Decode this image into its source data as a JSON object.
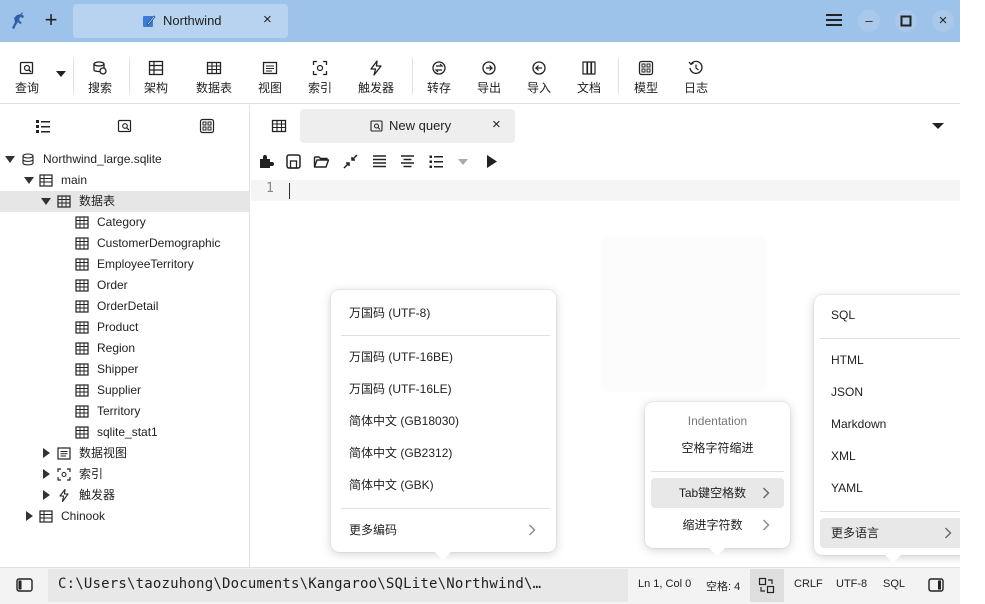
{
  "titlebar": {
    "new_tab": "+",
    "active_tab": "Northwind",
    "close_tab": "×",
    "minimize": "–",
    "maximize": "□",
    "close": "×"
  },
  "toolbar": {
    "items": [
      {
        "label": "查询",
        "icon": "query-icon"
      },
      {
        "label": "搜索",
        "icon": "search-db-icon"
      },
      {
        "label": "架构",
        "icon": "schema-icon"
      },
      {
        "label": "数据表",
        "icon": "table-icon"
      },
      {
        "label": "视图",
        "icon": "view-icon"
      },
      {
        "label": "索引",
        "icon": "index-icon"
      },
      {
        "label": "触发器",
        "icon": "trigger-icon"
      },
      {
        "label": "转存",
        "icon": "dump-icon"
      },
      {
        "label": "导出",
        "icon": "export-icon"
      },
      {
        "label": "导入",
        "icon": "import-icon"
      },
      {
        "label": "文档",
        "icon": "document-icon"
      },
      {
        "label": "模型",
        "icon": "model-icon"
      },
      {
        "label": "日志",
        "icon": "log-icon"
      }
    ]
  },
  "tree": {
    "root": "Northwind_large.sqlite",
    "schema": "main",
    "tables_group": "数据表",
    "tables": [
      "Category",
      "CustomerDemographic",
      "EmployeeTerritory",
      "Order",
      "OrderDetail",
      "Product",
      "Region",
      "Shipper",
      "Supplier",
      "Territory",
      "sqlite_stat1"
    ],
    "views_group": "数据视图",
    "index_group": "索引",
    "triggers_group": "触发器",
    "other_db": "Chinook"
  },
  "editor": {
    "tab_label": "New query",
    "tab_close": "×",
    "line_number": "1"
  },
  "statusbar": {
    "path": "C:\\Users\\taozuhong\\Documents\\Kangaroo\\SQLite\\Northwind\\…",
    "position": "Ln 1, Col 0",
    "spaces": "空格: 4",
    "line_ending": "CRLF",
    "encoding": "UTF-8",
    "language": "SQL"
  },
  "encoding_menu": {
    "items": [
      "万国码 (UTF-8)",
      "万国码 (UTF-16BE)",
      "万国码 (UTF-16LE)",
      "简体中文 (GB18030)",
      "简体中文 (GB2312)",
      "简体中文 (GBK)"
    ],
    "more": "更多编码"
  },
  "indent_menu": {
    "header": "Indentation",
    "spaces_option": "空格字符缩进",
    "tab_width": "Tab键空格数",
    "indent_width": "缩进字符数"
  },
  "language_menu": {
    "items": [
      "SQL",
      "HTML",
      "JSON",
      "Markdown",
      "XML",
      "YAML"
    ],
    "more": "更多语言"
  },
  "colors": {
    "titlebar": "#9ec3ea",
    "active_tab": "#b8d3f0",
    "selection": "#e6e6e6"
  }
}
